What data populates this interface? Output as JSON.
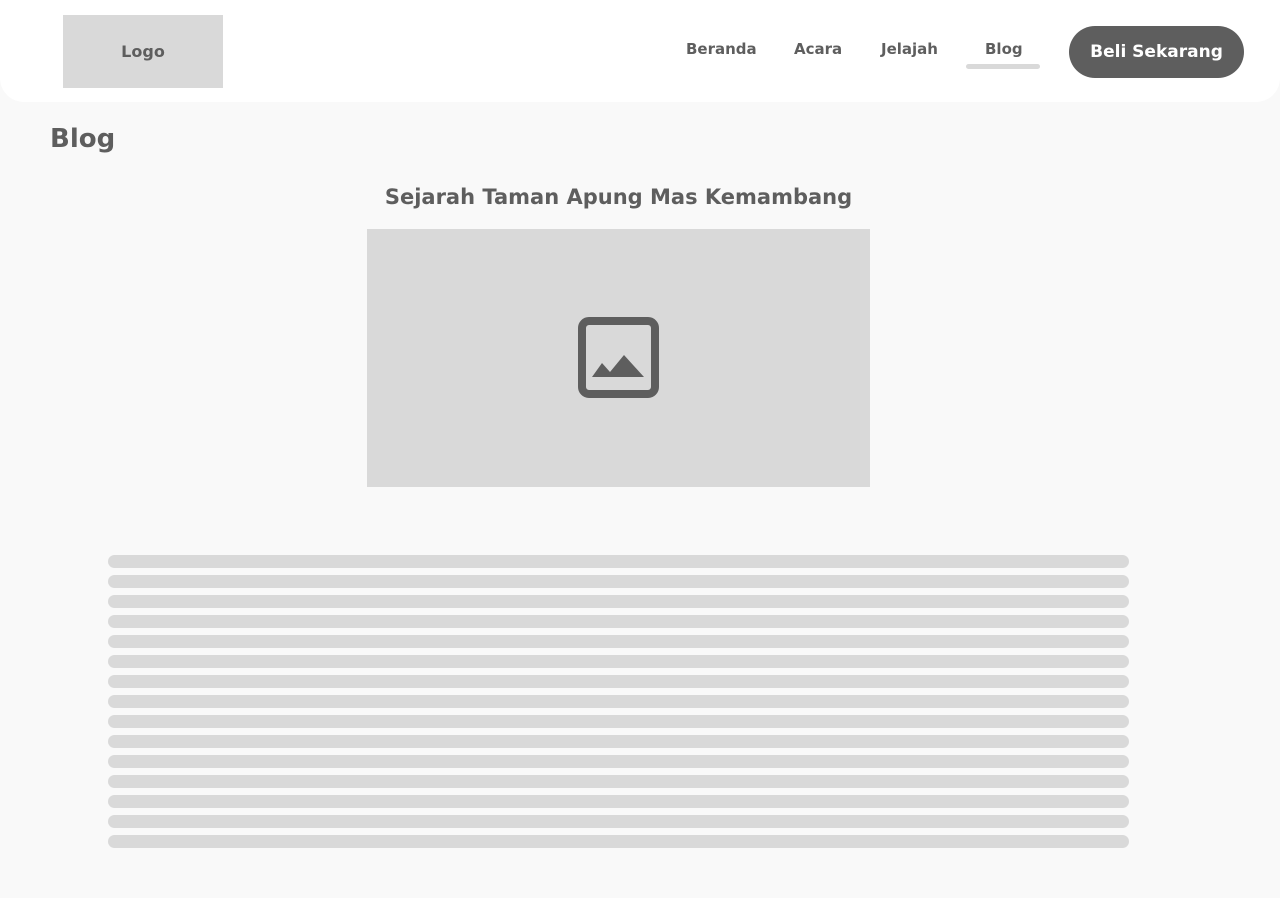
{
  "header": {
    "logo_text": "Logo",
    "nav": [
      {
        "label": "Beranda"
      },
      {
        "label": "Acara"
      },
      {
        "label": "Jelajah"
      },
      {
        "label": "Blog",
        "active": true
      }
    ],
    "cta_label": "Beli Sekarang"
  },
  "page": {
    "title": "Blog"
  },
  "post": {
    "title": "Sejarah Taman Apung Mas Kemambang",
    "image_icon": "image-icon",
    "placeholder_line_count": 15
  },
  "colors": {
    "page_background": "#f9f9f9",
    "header_background": "#ffffff",
    "placeholder": "#d9d9d9",
    "text": "#5e5e5e",
    "button_background": "#5e5e5e",
    "button_text": "#ffffff"
  }
}
